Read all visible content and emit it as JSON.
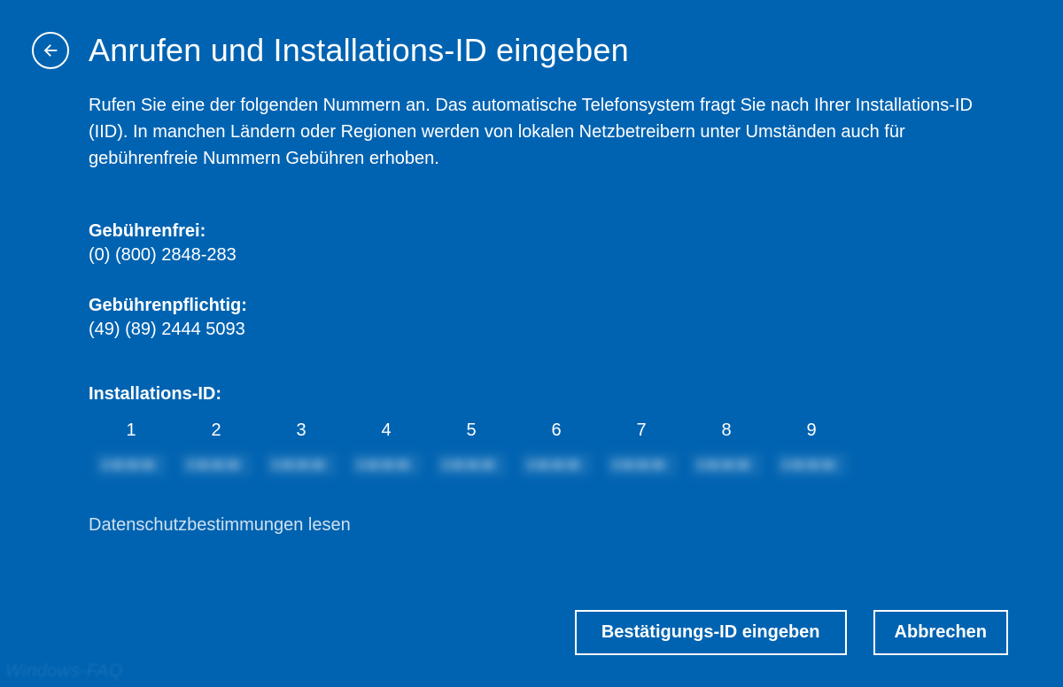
{
  "header": {
    "title": "Anrufen und Installations-ID eingeben"
  },
  "instructions": "Rufen Sie eine der folgenden Nummern an. Das automatische Telefonsystem fragt Sie nach Ihrer Installations-ID (IID). In manchen Ländern oder Regionen werden von lokalen Netzbetreibern unter Umständen auch für gebührenfreie Nummern Gebühren erhoben.",
  "toll_free": {
    "label": "Gebührenfrei:",
    "number": "(0) (800) 2848-283"
  },
  "toll": {
    "label": "Gebührenpflichtig:",
    "number": "(49) (89) 2444 5093"
  },
  "installation_id": {
    "label": "Installations-ID:",
    "columns": {
      "c1": "1",
      "c2": "2",
      "c3": "3",
      "c4": "4",
      "c5": "5",
      "c6": "6",
      "c7": "7",
      "c8": "8",
      "c9": "9"
    }
  },
  "links": {
    "privacy": "Datenschutzbestimmungen lesen"
  },
  "buttons": {
    "confirm": "Bestätigungs-ID eingeben",
    "cancel": "Abbrechen"
  },
  "watermark": "Windows-FAQ"
}
